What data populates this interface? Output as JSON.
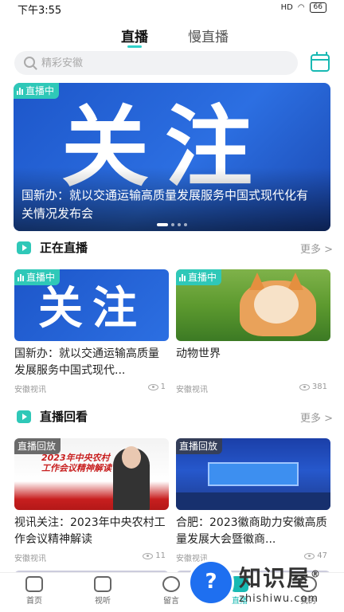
{
  "status_bar": {
    "time": "下午3:55",
    "signal": "HD",
    "battery": "66"
  },
  "tabs": [
    {
      "label": "直播"
    },
    {
      "label": "慢直播"
    }
  ],
  "search": {
    "placeholder": "精彩安徽"
  },
  "banner": {
    "badge": "直播中",
    "image_text": "关注",
    "caption": "国新办：就以交通运输高质量发展服务中国式现代化有关情况发布会",
    "pages": 4,
    "active_page": 1
  },
  "live_section": {
    "title": "正在直播",
    "more": "更多 >",
    "cards": [
      {
        "badge": "直播中",
        "image_text": "关注",
        "title": "国新办：就以交通运输高质量发展服务中国式现代...",
        "source": "安徽视讯",
        "views": "1"
      },
      {
        "badge": "直播中",
        "title": "动物世界",
        "source": "安徽视讯",
        "views": "381"
      }
    ]
  },
  "replay_section": {
    "title": "直播回看",
    "more": "更多 >",
    "cards": [
      {
        "badge": "直播回放",
        "image_text": "2023年中央农村工作会议精神解读",
        "title": "视讯关注：2023年中央农村工作会议精神解读",
        "source": "安徽视讯",
        "views": "11"
      },
      {
        "badge": "直播回放",
        "title": "合肥：2023徽商助力安徽高质量发展大会暨徽商...",
        "source": "安徽视讯",
        "views": "47"
      }
    ]
  },
  "bottom_nav": [
    {
      "label": "首页"
    },
    {
      "label": "视听"
    },
    {
      "label": "留言"
    },
    {
      "label": "直播"
    },
    {
      "label": "我的"
    }
  ],
  "watermark": {
    "name": "知识屋",
    "url": "zhishiwu.com",
    "mark": "®"
  },
  "colors": {
    "accent": "#2fc8b8",
    "banner_blue": "#2c6fe2"
  }
}
